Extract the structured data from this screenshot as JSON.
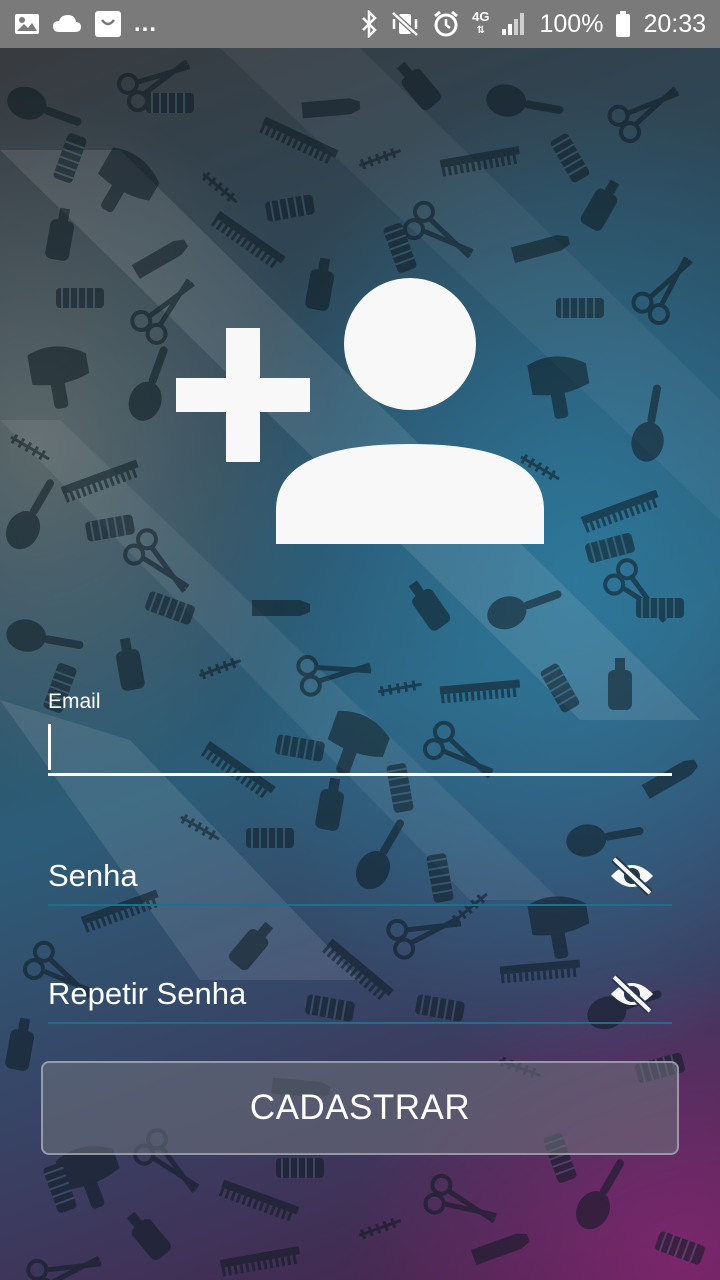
{
  "status_bar": {
    "left_icons": [
      "image-icon",
      "cloud-icon",
      "shopping-bag-icon"
    ],
    "overflow": "...",
    "right_icons": [
      "bluetooth-icon",
      "vibrate-mute-icon",
      "alarm-icon",
      "network-4g-icon",
      "signal-icon",
      "battery-icon"
    ],
    "network_label": "4G",
    "battery_percent": "100%",
    "time": "20:33"
  },
  "header": {
    "icon": "add-user-icon"
  },
  "form": {
    "email": {
      "label": "Email",
      "value": ""
    },
    "password": {
      "placeholder": "Senha",
      "toggle_icon": "eye-off-icon"
    },
    "repeat_password": {
      "placeholder": "Repetir Senha",
      "toggle_icon": "eye-off-icon"
    },
    "submit_label": "CADASTRAR"
  },
  "colors": {
    "status_bar": "#7a7a7a",
    "text": "#ffffff",
    "field_underline": "#1f6f8b",
    "icon": "#f8f8f8"
  }
}
